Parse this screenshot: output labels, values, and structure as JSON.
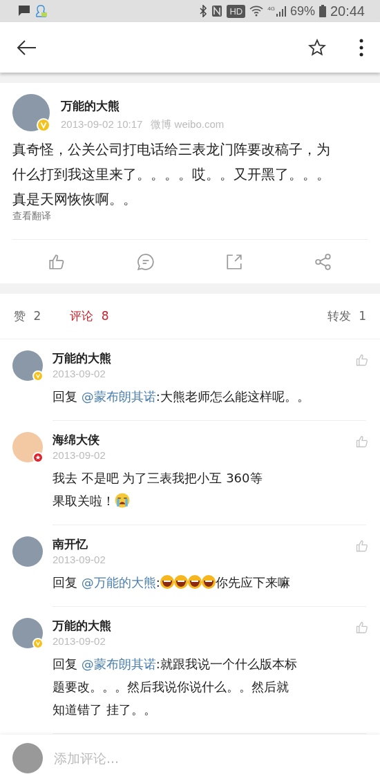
{
  "status_bar": {
    "hd": "HD",
    "network": "4G",
    "battery": "69%",
    "time": "20:44"
  },
  "post": {
    "author": "万能的大熊",
    "avatar": {
      "kind": "photo"
    },
    "badge": {
      "kind": "verified"
    },
    "time": "2013-09-02 10:17",
    "source": "微博 weibo.com",
    "lines": [
      "真奇怪，公关公司打电话给三表龙门阵要改稿子，为",
      "什么打到我这里来了。。。。哎。。又开黑了。。。",
      "真是天网恢恢啊。。"
    ],
    "translate": "查看翻译"
  },
  "tabs": [
    {
      "label": "赞",
      "count": "2",
      "selected": false
    },
    {
      "label": "评论",
      "count": "8",
      "selected": true
    },
    {
      "label": "转发",
      "count": "1",
      "selected": false
    }
  ],
  "comments": [
    {
      "author": "万能的大熊",
      "avatar": {
        "kind": "photo"
      },
      "badge": {
        "kind": "verified"
      },
      "date": "2013-09-02",
      "body": [
        {
          "kind": "text",
          "text": "回复 "
        },
        {
          "kind": "mention",
          "text": "@蒙布朗其诺"
        },
        {
          "kind": "text",
          "text": ":大熊老师怎么能这样呢。。"
        }
      ]
    },
    {
      "author": "海绵大侠",
      "avatar": {
        "kind": "cartoon"
      },
      "badge": {
        "kind": "star"
      },
      "date": "2013-09-02",
      "body": [
        {
          "kind": "text",
          "text": "我去 不是吧 为了三表我把小互 360等"
        },
        {
          "kind": "break"
        },
        {
          "kind": "text",
          "text": "果取关啦！"
        },
        {
          "kind": "crying_emoji"
        }
      ]
    },
    {
      "author": "南开忆",
      "avatar": {
        "kind": "photo"
      },
      "date": "2013-09-02",
      "body": [
        {
          "kind": "text",
          "text": "回复 "
        },
        {
          "kind": "mention",
          "text": "@万能的大熊"
        },
        {
          "kind": "text",
          "text": ":"
        },
        {
          "kind": "laughing_emoji"
        },
        {
          "kind": "laughing_emoji"
        },
        {
          "kind": "laughing_emoji"
        },
        {
          "kind": "laughing_emoji"
        },
        {
          "kind": "text",
          "text": "你先应下来嘛"
        }
      ]
    },
    {
      "author": "万能的大熊",
      "avatar": {
        "kind": "photo"
      },
      "badge": {
        "kind": "verified"
      },
      "date": "2013-09-02",
      "body": [
        {
          "kind": "text",
          "text": "回复 "
        },
        {
          "kind": "mention",
          "text": "@蒙布朗其诺"
        },
        {
          "kind": "text",
          "text": ":就跟我说一个什么版本标"
        },
        {
          "kind": "break"
        },
        {
          "kind": "text",
          "text": "题要改。。。然后我说你说什么。。然后就"
        },
        {
          "kind": "break"
        },
        {
          "kind": "text",
          "text": "知道错了 挂了。。"
        }
      ]
    }
  ],
  "composer": {
    "placeholder": "添加评论..."
  }
}
